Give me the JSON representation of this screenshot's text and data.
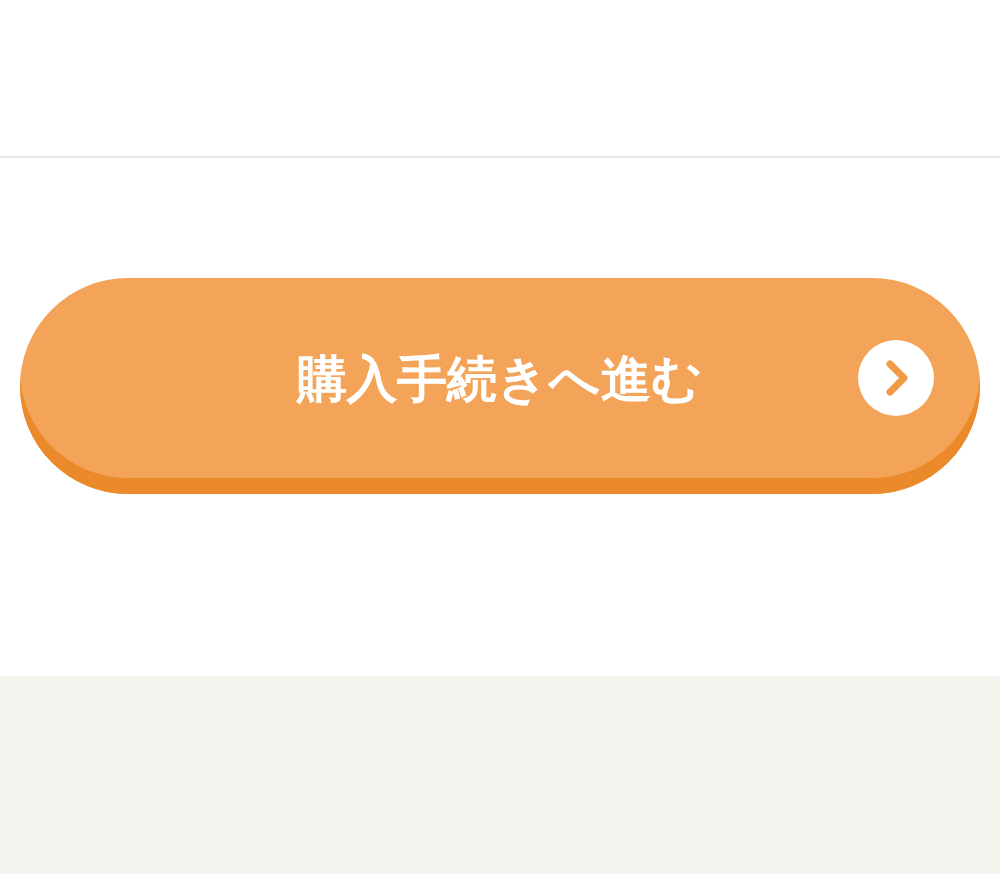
{
  "checkout_button": {
    "label": "購入手続きへ進む"
  }
}
